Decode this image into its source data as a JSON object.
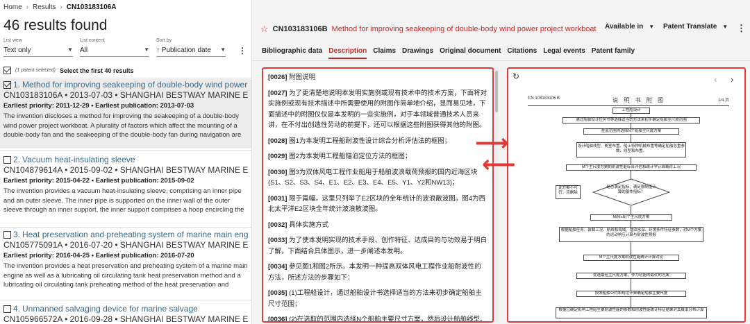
{
  "breadcrumb": {
    "home": "Home",
    "results": "Results",
    "current": "CN103183106A"
  },
  "results_count": "46 results found",
  "filters": [
    {
      "label": "List view",
      "value": "Text only"
    },
    {
      "label": "List content",
      "value": "All"
    },
    {
      "label": "Sort by",
      "value": "↑ Publication date"
    }
  ],
  "selection": {
    "note": "(1 patent selected)",
    "action": "Select the first 40 results"
  },
  "results": [
    {
      "num": "1.",
      "title": "Method for improving seakeeping of double-body wind power p",
      "meta": "CN103183106A • 2013-07-03 • SHANGHAI BESTWAY MARINE ENG",
      "priority": "Earliest priority: 2011-12-29 • Earliest publication: 2013-07-03",
      "abstract": "The invention discloses a method for improving the seakeeping of a double-body wind power project workboat. A plurality of factors which affect the mounting of a double-body fan and the seakeeping of the double-body fan during navigation are"
    },
    {
      "num": "2.",
      "title": "Vacuum heat-insulating sleeve",
      "meta": "CN104879614A • 2015-09-02 • SHANGHAI BESTWAY MARINE ENG",
      "priority": "Earliest priority: 2015-04-22 • Earliest publication: 2015-09-02",
      "abstract": "The invention provides a vacuum heat-insulating sleeve, comprising an inner pipe and an outer sleeve. The inner pipe is supported on the inner wall of the outer sleeve through an inner support, the inner support comprises a hoop encircling the outer"
    },
    {
      "num": "3.",
      "title": "Heat preservation and preheating system of marine main engine",
      "meta": "CN105775091A • 2016-07-20 • SHANGHAI BESTWAY MARINE ENG",
      "priority": "Earliest priority: 2016-04-25 • Earliest publication: 2016-07-20",
      "abstract": "The invention provides a heat preservation and preheating system of a marine main engine as well as a lubricating oil circulating tank heat preservation method and a lubricating oil circulating tank preheating method of the heat preservation and"
    },
    {
      "num": "4.",
      "title": "Unmanned salvaging device for marine salvage",
      "meta": "CN105966572A • 2016-09-28 • SHANGHAI BESTWAY MARINE ENG",
      "priority": "",
      "abstract": ""
    }
  ],
  "patent": {
    "number": "CN103183106B",
    "title": "Method for improving seakeeping of double-body wind power project workboat",
    "available_in": "Available in",
    "translate": "Patent Translate"
  },
  "tabs": [
    "Bibliographic data",
    "Description",
    "Claims",
    "Drawings",
    "Original document",
    "Citations",
    "Legal events",
    "Patent family"
  ],
  "description": [
    {
      "tag": "[0026]",
      "text": " 附图说明"
    },
    {
      "tag": "[0027]",
      "text": " 为了更清楚地说明本发明实施例或现有技术中的技术方案，下面将对实施例或现有技术描述中所需要使用的附图作简单地介绍，显而易见地，下面描述中的附图仅仅是本发明的一些实施例，对于本领域普通技术人员来讲，在不付出创造性劳动的前提下，还可以根据这些附图获得其他的附图。"
    },
    {
      "tag": "[0028]",
      "text": " 图1为本发明工程船耐波性设计综合分析评估法的框图；"
    },
    {
      "tag": "[0029]",
      "text": " 图2为本发明工程船锚泊定位方法的框图；"
    },
    {
      "tag": "[0030]",
      "text": " 图3为双体风电工程作业船用于船舶波浪载荷预报的国内近海区块(S1、S2、S3、S4、E1、E2、E3、E4、E5、Y1、Y2和NW13)；"
    },
    {
      "tag": "[0031]",
      "text": " 限于篇幅，这里只列举了E2区块的全年统计的波浪散波图。图4为西北太平洋E2区块全年统计波浪散波图。"
    },
    {
      "tag": "[0032]",
      "text": " 具体实施方式"
    },
    {
      "tag": "[0033]",
      "text": " 为了使本发明实现的技术手段、创作特征、达成目的与功效易于明白了解，下面结合具体图示，进一步阐述本发明。"
    },
    {
      "tag": "[0034]",
      "text": " 参见图1和图2所示。本发明一种提高双体风电工程作业船耐波性的方法，所述方法的步骤如下："
    },
    {
      "tag": "[0035]",
      "text": " (1)工程船设计，通过船舶设计书选择适当的方法来初步确定船舶主尺寸范围；"
    },
    {
      "tag": "[0036]",
      "text": " (2)在选取的范围内选择N个船舶主要尺寸方案，然后设计船舶线型、船"
    }
  ],
  "drawing": {
    "header_left": "CN 103183106 B",
    "header_mid": "说 明 书 附 图",
    "header_right": "1/4 页",
    "boxes": [
      "工程船设计",
      "通过船舶设计任务书等选择适当的方法来初步确定船舶主尺度范围",
      "在此范围内选择N个船舶主尺度方案",
      "设计船舶线型、舱室布置、船上特种机械布置等确定船舶总重参数、线型和布置。",
      "M个主尺度方案的耐波性能综合评估和统计学计算载荷工况",
      "是否满足指标、满足限制值计算的基本指标？",
      "M(M≤N)个主尺度方案",
      "根据船舶任务、装载工况、航线和海域、锚泊水深、环境条件特征参数，对M个方案的运动响应计算与耐波性预报",
      "M个主尺度方案耐波性能统计计算对比",
      "优选最佳主尺度方案，作为初始的最优的方案",
      "按照船舶公约和规范计算确定船舶主要尺度",
      "根据已确定影响工程船主要耐波性能的参数和耐波性能统计特征结果对其概率分布计算",
      "此方案不可行，应删除"
    ]
  }
}
